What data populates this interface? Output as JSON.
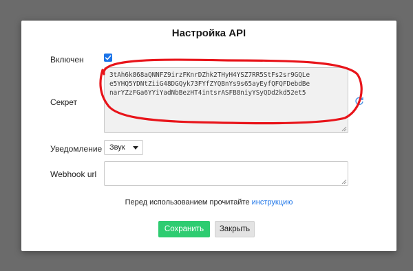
{
  "dialog": {
    "title": "Настройка API",
    "enabled": {
      "label": "Включен",
      "checked": true
    },
    "secret": {
      "label": "Секрет",
      "lines": [
        "3tAh6k868aQNNFZ9irzFKnrDZhk2THyH4YSZ7RR5StFs2sr9GQLe",
        "e5YHQ5YDNtZiiG48DGQyk73FYfZYQBnYs9s65ayEyfQFQFDebdBe",
        "narYZzFGa6YYiYadNbBezHT4intsrASFB8niyYSyQDd2kd52et5"
      ]
    },
    "notification": {
      "label": "Уведомление",
      "selected": "Звук"
    },
    "webhook": {
      "label": "Webhook url",
      "value": ""
    },
    "note": {
      "text": "Перед использованием прочитайте ",
      "link": "инструкцию"
    },
    "buttons": {
      "save": "Сохранить",
      "close": "Закрыть"
    }
  },
  "colors": {
    "accent": "#1a73e8",
    "save": "#2ecc71",
    "annotation": "#e8141a"
  },
  "icons": {
    "refresh": "refresh-icon",
    "checkbox": "checkmark-icon"
  }
}
